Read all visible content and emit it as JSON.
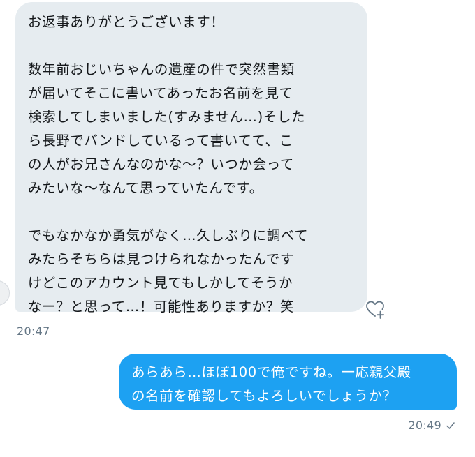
{
  "conversation": {
    "incoming": {
      "paragraphs": [
        "お返事ありがとうございます！",
        "数年前おじいちゃんの遺産の件で突然書類\nが届いてそこに書いてあったお名前を見て\n検索してしまいました(すみません…)そした\nら長野でバンドしているって書いてて、こ\nの人がお兄さんなのかな〜？いつか会って\nみたいな〜なんて思っていたんです。",
        "でもなかなか勇気がなく…久しぶりに調べて\nみたらそちらは見つけられなかったんです\nけどこのアカウント見てもしかしてそうか\nなー？と思って…！可能性ありますか？笑"
      ],
      "time": "20:47",
      "like_icon": "heart-plus-icon"
    },
    "outgoing": {
      "text": "あらあら…ほぼ100で俺ですね。一応親父殿\nの名前を確認してもよろしいでしょうか？",
      "time": "20:49",
      "status_icon": "checkmark-icon"
    }
  },
  "colors": {
    "incoming_bubble": "#e6ecf0",
    "outgoing_bubble": "#1da1f2",
    "timestamp": "#657786"
  }
}
